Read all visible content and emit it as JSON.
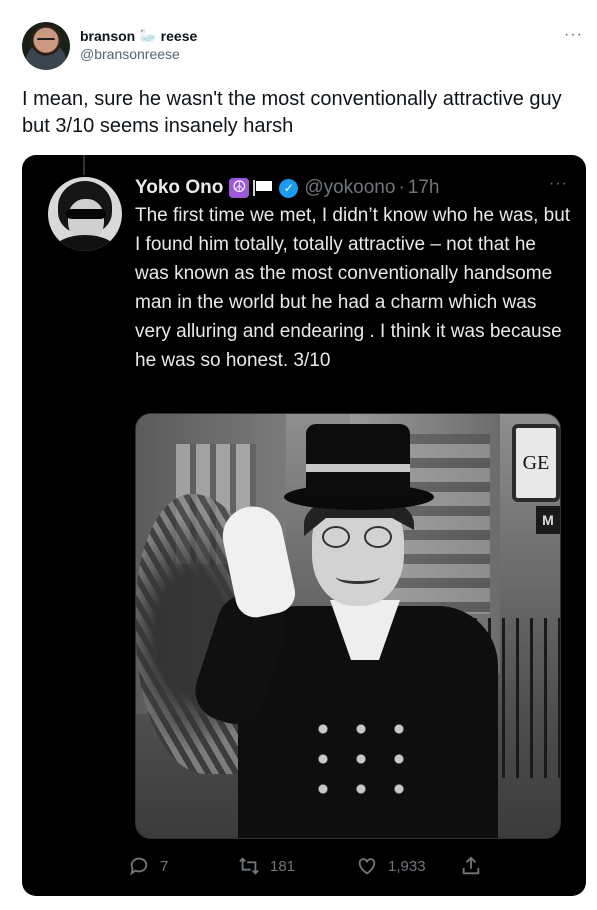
{
  "outer_tweet": {
    "display_first": "branson",
    "display_last": "reese",
    "display_icon": "swan-icon",
    "handle": "@bransonreese",
    "more": "···",
    "text": "I mean, sure he wasn't the most conventionally attractive guy but 3/10 seems insanely harsh"
  },
  "quoted_tweet": {
    "name": "Yoko Ono",
    "badges": [
      "peace-icon",
      "white-flag-icon",
      "verified-icon"
    ],
    "peace_glyph": "☮",
    "verified_glyph": "✓",
    "handle": "@yokoono",
    "separator": "·",
    "time": "17h",
    "more": "···",
    "text": "The first time we met, I didn’t know who he was, but I found him totally, totally attractive – not that he was known as the most conventionally handsome man in the world but he had a charm which was very alluring and endearing . I think it was because he was so honest. 3/10",
    "photo": {
      "sign_text": "GE",
      "sign2_text": "M"
    },
    "actions": {
      "replies": "7",
      "retweets": "181",
      "likes": "1,933"
    }
  },
  "colors": {
    "card_bg": "#000000",
    "text_dark": "#e7e9ea",
    "muted": "#71767b",
    "verified": "#1d9bf0",
    "peace_badge": "#9b59d9"
  }
}
